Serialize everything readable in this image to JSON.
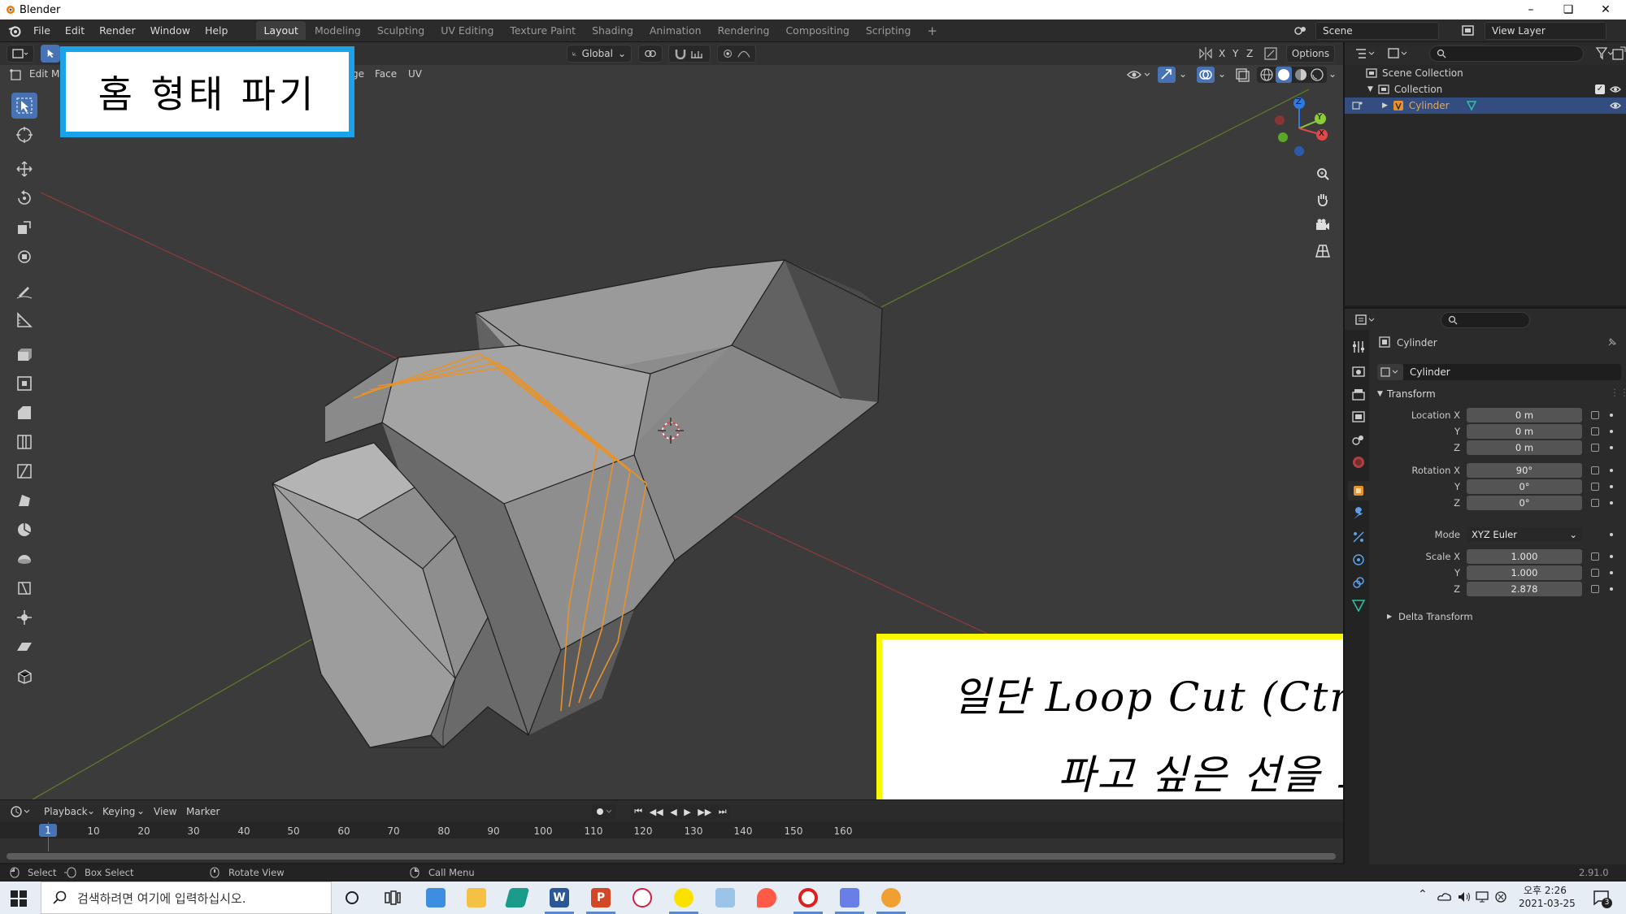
{
  "window": {
    "title": "Blender"
  },
  "menu": {
    "file": "File",
    "edit": "Edit",
    "render": "Render",
    "window": "Window",
    "help": "Help"
  },
  "workspaces": [
    "Layout",
    "Modeling",
    "Sculpting",
    "UV Editing",
    "Texture Paint",
    "Shading",
    "Animation",
    "Rendering",
    "Compositing",
    "Scripting"
  ],
  "scene": {
    "label": "Scene",
    "view_layer": "View Layer"
  },
  "viewport": {
    "transform_orientation": "Global",
    "axis_x": "X",
    "axis_y": "Y",
    "axis_z": "Z",
    "options": "Options",
    "edit_mode": "Edit Mo",
    "menu_edge": "ge",
    "menu_face": "Face",
    "menu_uv": "UV",
    "gizmo_x": "X",
    "gizmo_y": "Y",
    "gizmo_z": "Z"
  },
  "annotations": {
    "top_left": "홈 형태 파기",
    "bottom_line1": "일단 Loop Cut (Ctrl + R)로",
    "bottom_line2": "파고 싶은 선을 표시"
  },
  "timeline": {
    "playback": "Playback",
    "keying": "Keying",
    "view": "View",
    "marker": "Marker",
    "current_frame": "1",
    "frames": [
      "10",
      "20",
      "30",
      "40",
      "50",
      "60",
      "70",
      "80",
      "90",
      "100",
      "110",
      "120",
      "130",
      "140",
      "150",
      "160"
    ]
  },
  "statusbar": {
    "select": "Select",
    "box_select": "Box Select",
    "rotate_view": "Rotate View",
    "call_menu": "Call Menu",
    "version": "2.91.0"
  },
  "outliner": {
    "scene_collection": "Scene Collection",
    "collection": "Collection",
    "object": "Cylinder"
  },
  "properties": {
    "object_name": "Cylinder",
    "data_name": "Cylinder",
    "transform_label": "Transform",
    "location_label": "Location X",
    "loc_x": "0 m",
    "loc_y": "0 m",
    "loc_z": "0 m",
    "rotation_label": "Rotation X",
    "rot_x": "90°",
    "rot_y": "0°",
    "rot_z": "0°",
    "mode_label": "Mode",
    "mode_value": "XYZ Euler",
    "scale_label": "Scale X",
    "scale_x": "1.000",
    "scale_y": "1.000",
    "scale_z": "2.878",
    "y_label": "Y",
    "z_label": "Z",
    "delta_transform": "Delta Transform"
  },
  "taskbar": {
    "search_placeholder": "검색하려면 여기에 입력하십시오.",
    "time": "오후 2:26",
    "date": "2021-03-25",
    "notification_count": "3"
  },
  "colors": {
    "accent": "#4772b3",
    "orange_edge": "#e8922a",
    "blue_box": "#1aa3e8",
    "yellow_box": "#f8f800"
  }
}
